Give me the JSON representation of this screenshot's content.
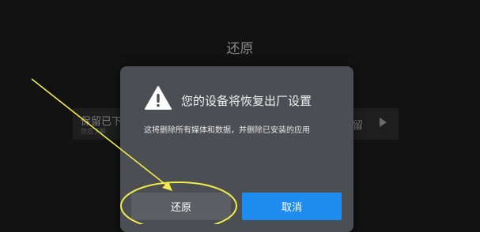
{
  "page": {
    "title": "还原"
  },
  "background_option": {
    "left_text": "保留已下",
    "sub_text": "您应了解",
    "right_text": "留",
    "play_icon": "play-icon"
  },
  "dialog": {
    "icon": "warning-icon",
    "title": "您的设备将恢复出厂设置",
    "message": "这将删除所有媒体和数据，并删除已安装的应用",
    "buttons": {
      "restore": "还原",
      "cancel": "取消"
    }
  },
  "annotation": {
    "color": "#f2ec4a",
    "shapes": [
      "arrow",
      "ellipse"
    ]
  },
  "colors": {
    "background": "#121212",
    "dialog": "#4b4e53",
    "primary_button": "#1f8cf0",
    "secondary_button": "#5b5e63"
  }
}
